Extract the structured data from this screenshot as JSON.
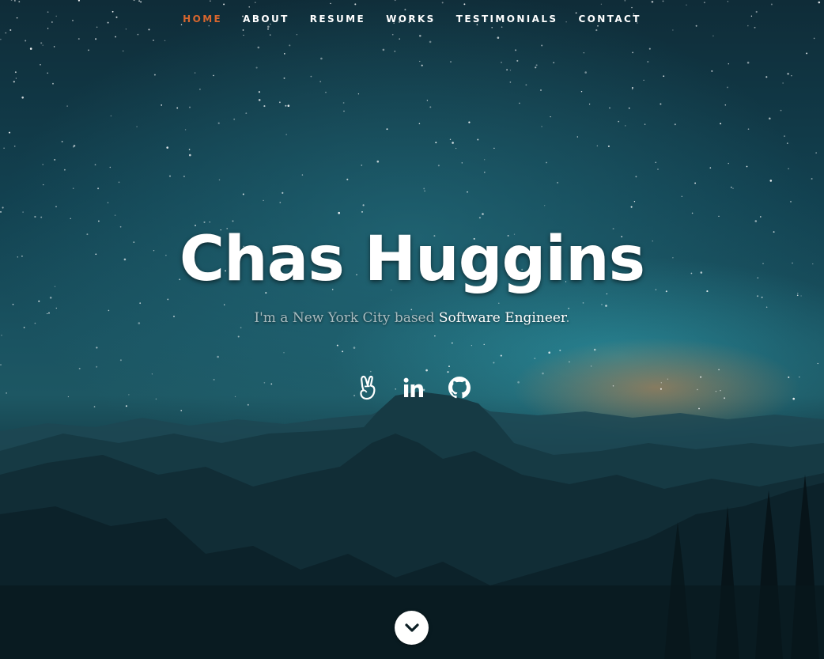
{
  "nav": {
    "items": [
      {
        "label": "HOME",
        "active": true
      },
      {
        "label": "ABOUT",
        "active": false
      },
      {
        "label": "RESUME",
        "active": false
      },
      {
        "label": "WORKS",
        "active": false
      },
      {
        "label": "TESTIMONIALS",
        "active": false
      },
      {
        "label": "CONTACT",
        "active": false
      }
    ]
  },
  "banner": {
    "name": "Chas Huggins",
    "intro_prefix": "I'm a New York City based ",
    "intro_highlight": "Software Engineer",
    "intro_suffix": "."
  },
  "social": [
    {
      "icon": "angellist-icon"
    },
    {
      "icon": "linkedin-icon"
    },
    {
      "icon": "github-icon"
    }
  ],
  "scroll_down": {
    "icon": "chevron-down-icon"
  },
  "colors": {
    "accent": "#d8662e",
    "text": "#ffffff",
    "subtitle": "#a9bcc0"
  }
}
